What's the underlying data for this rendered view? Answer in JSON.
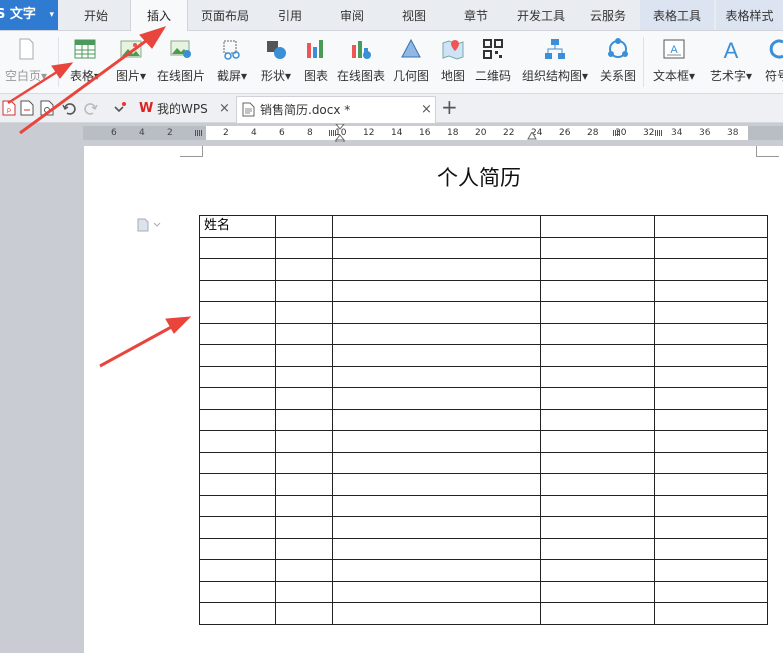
{
  "app": {
    "title": "S 文字",
    "menu_arrow": "▾"
  },
  "ribbon_tabs": [
    {
      "label": "开始",
      "active": false
    },
    {
      "label": "插入",
      "active": true
    },
    {
      "label": "页面布局",
      "active": false
    },
    {
      "label": "引用",
      "active": false
    },
    {
      "label": "审阅",
      "active": false
    },
    {
      "label": "视图",
      "active": false
    },
    {
      "label": "章节",
      "active": false
    },
    {
      "label": "开发工具",
      "active": false
    },
    {
      "label": "云服务",
      "active": false
    },
    {
      "label": "表格工具",
      "active": false,
      "contextual": true
    },
    {
      "label": "表格样式",
      "active": false,
      "contextual": true
    }
  ],
  "ribbon_buttons": [
    {
      "label": "空白页▾",
      "icon": "blank-page-icon"
    },
    {
      "label": "表格▾",
      "icon": "table-icon"
    },
    {
      "label": "图片▾",
      "icon": "picture-icon"
    },
    {
      "label": "在线图片",
      "icon": "online-picture-icon"
    },
    {
      "label": "截屏▾",
      "icon": "screenshot-icon"
    },
    {
      "label": "形状▾",
      "icon": "shapes-icon"
    },
    {
      "label": "图表",
      "icon": "chart-icon"
    },
    {
      "label": "在线图表",
      "icon": "online-chart-icon"
    },
    {
      "label": "几何图",
      "icon": "geometry-icon"
    },
    {
      "label": "地图",
      "icon": "map-icon"
    },
    {
      "label": "二维码",
      "icon": "qrcode-icon"
    },
    {
      "label": "组织结构图▾",
      "icon": "org-chart-icon"
    },
    {
      "label": "关系图",
      "icon": "relation-icon"
    },
    {
      "label": "文本框▾",
      "icon": "textbox-icon"
    },
    {
      "label": "艺术字▾",
      "icon": "wordart-icon"
    },
    {
      "label": "符号",
      "icon": "symbol-icon"
    }
  ],
  "doc_tabs": [
    {
      "label": "我的WPS",
      "active": false
    },
    {
      "label": "销售简历.docx *",
      "active": true
    }
  ],
  "new_tab_symbol": "+",
  "close_symbol": "×",
  "ruler_left": [
    "6",
    "4",
    "2"
  ],
  "ruler_white": [
    "2",
    "4",
    "6",
    "8",
    "10",
    "12",
    "14",
    "16",
    "18",
    "20",
    "22",
    "24",
    "26",
    "28",
    "30",
    "32"
  ],
  "ruler_right": [
    "34",
    "36",
    "38"
  ],
  "document": {
    "title": "个人简历",
    "table_rows": 19,
    "table_cols": 5,
    "first_cell": "姓名"
  },
  "colors": {
    "accent": "#2e7bd1",
    "arrow": "#e8453c"
  }
}
